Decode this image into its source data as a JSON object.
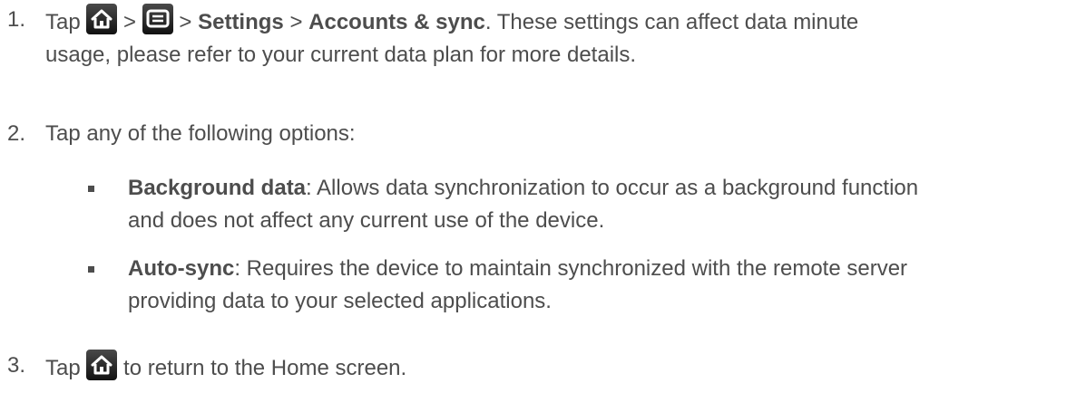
{
  "steps": [
    {
      "number": "1.",
      "tap": "Tap",
      "sep1": ">",
      "sep2": ">",
      "settings": "Settings",
      "sep3": ">",
      "accounts": "Accounts & sync",
      "rest_line1": ". These settings can affect data minute",
      "rest_line2": "usage, please refer to your current data plan for more details.",
      "icons": [
        "home-icon",
        "menu-icon"
      ]
    },
    {
      "number": "2.",
      "text": "Tap any of the following options:"
    },
    {
      "number": "3.",
      "tap": "Tap",
      "rest": "to return to the Home screen.",
      "icons": [
        "home-icon"
      ]
    }
  ],
  "options": [
    {
      "term": "Background data",
      "line1": ": Allows data synchronization to occur as a background function",
      "line2": "and does not affect any current use of the device."
    },
    {
      "term": "Auto-sync",
      "line1": ": Requires the device to maintain synchronized with the remote server",
      "line2": "providing data to your selected applications."
    }
  ],
  "colors": {
    "text": "#4d4d4d",
    "icon_background": "#1a1a1a",
    "icon_glyph": "#ffffff"
  }
}
